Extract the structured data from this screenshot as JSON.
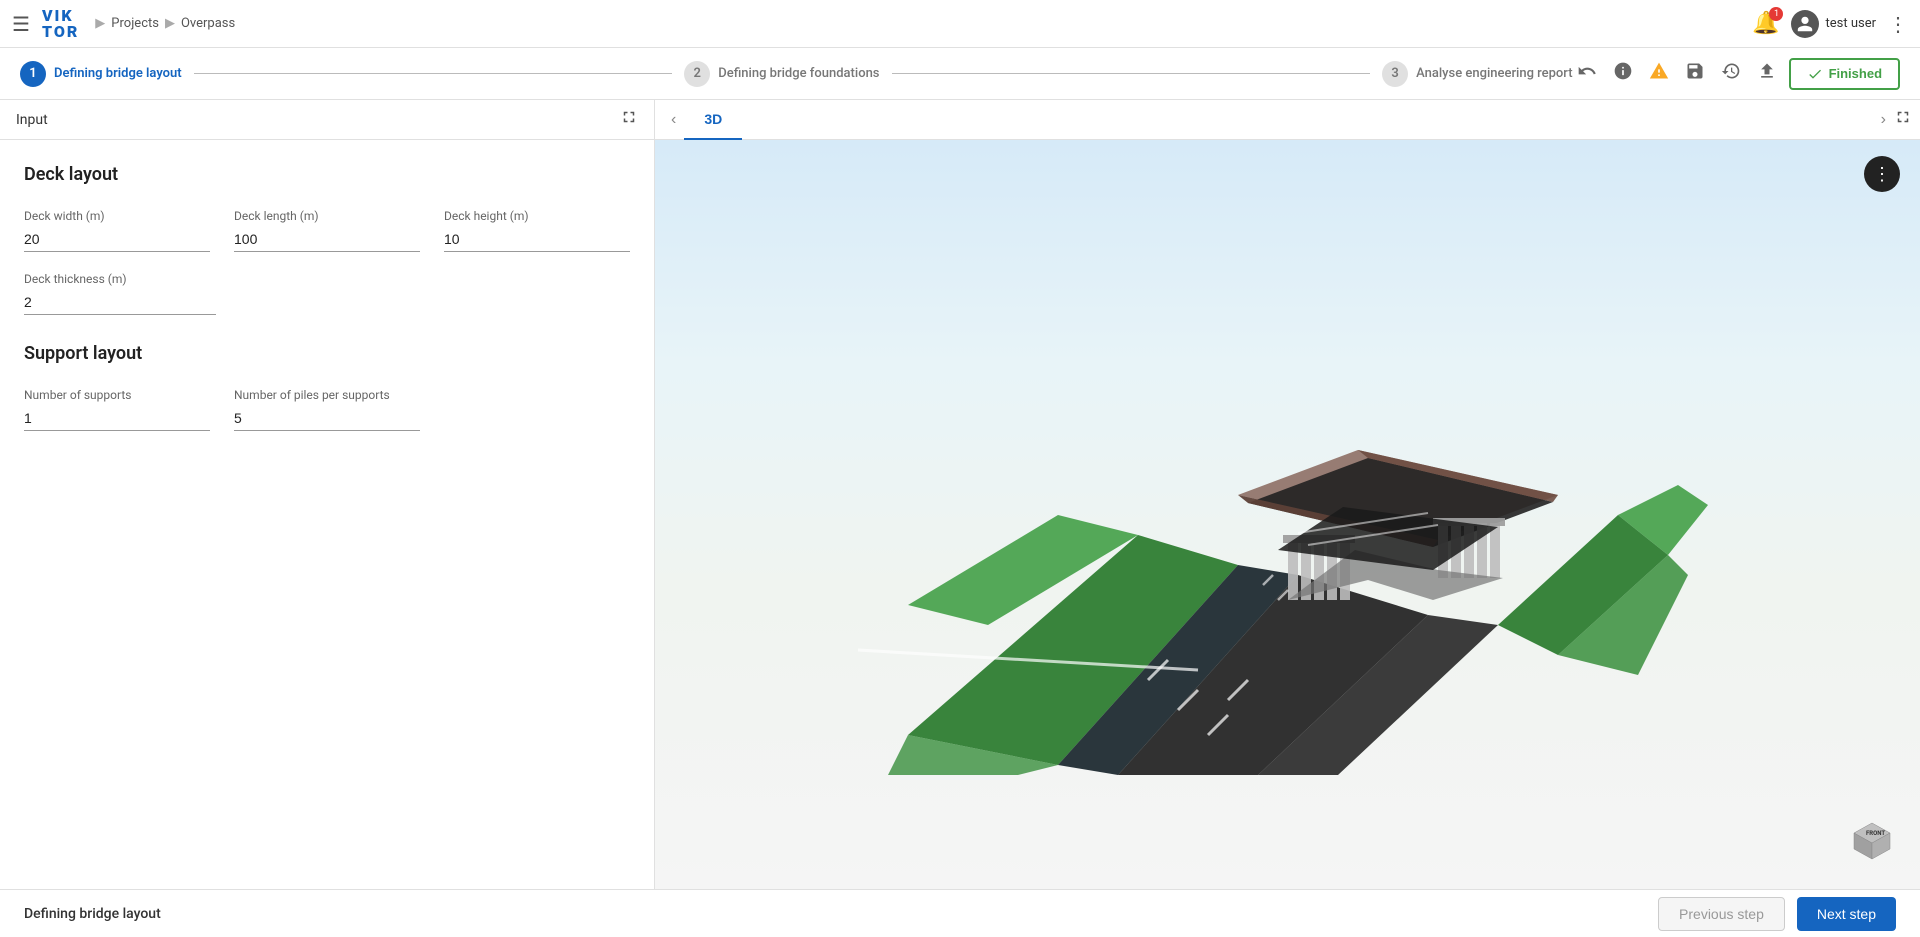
{
  "app": {
    "name": "VIKTOR",
    "logo_line1": "VIK",
    "logo_line2": "TOR"
  },
  "breadcrumb": {
    "projects_label": "Projects",
    "current_label": "Overpass"
  },
  "user": {
    "name": "test user",
    "avatar_initial": "U"
  },
  "wizard": {
    "step1_num": "1",
    "step1_label": "Defining bridge layout",
    "step2_num": "2",
    "step2_label": "Defining bridge foundations",
    "step3_num": "3",
    "step3_label": "Analyse engineering report",
    "finished_label": "Finished"
  },
  "left_panel": {
    "input_label": "Input",
    "deck_layout_title": "Deck layout",
    "deck_width_label": "Deck width (m)",
    "deck_width_value": "20",
    "deck_length_label": "Deck length (m)",
    "deck_length_value": "100",
    "deck_height_label": "Deck height (m)",
    "deck_height_value": "10",
    "deck_thickness_label": "Deck thickness (m)",
    "deck_thickness_value": "2",
    "support_layout_title": "Support layout",
    "num_supports_label": "Number of supports",
    "num_supports_value": "1",
    "num_piles_label": "Number of piles per supports",
    "num_piles_value": "5"
  },
  "viewer": {
    "tab_3d_label": "3D",
    "dots_menu_icon": "⋮"
  },
  "bottom": {
    "title": "Defining bridge layout",
    "prev_label": "Previous step",
    "next_label": "Next step"
  }
}
